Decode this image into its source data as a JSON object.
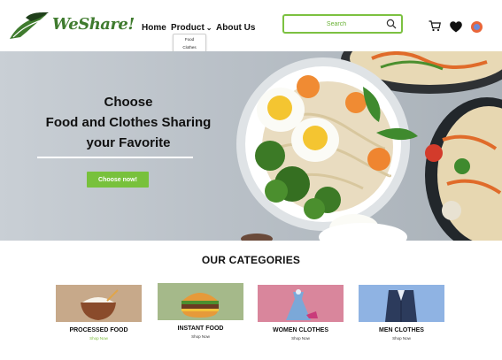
{
  "brand": {
    "name": "WeShare!"
  },
  "nav": {
    "home": "Home",
    "product": "Product",
    "about": "About Us",
    "product_menu": [
      "Food",
      "Clothes"
    ]
  },
  "search": {
    "placeholder": "Search"
  },
  "hero": {
    "line1": "Choose",
    "line2": "Food and Clothes Sharing",
    "line3": "your Favorite",
    "cta": "Choose now!"
  },
  "categories": {
    "heading": "OUR CATEGORIES",
    "items": [
      {
        "name": "PROCESSED FOOD",
        "link": "Shop Now"
      },
      {
        "name": "INSTANT FOOD",
        "link": "Shop Now"
      },
      {
        "name": "WOMEN CLOTHES",
        "link": "Shop Now"
      },
      {
        "name": "MEN CLOTHES",
        "link": "Shop Now"
      }
    ]
  },
  "colors": {
    "accent": "#78c13c",
    "brand_green": "#3f7b2e",
    "search_border": "#7cc141"
  },
  "icons": [
    "logo-leaf-icon",
    "search-icon",
    "cart-icon",
    "heart-icon",
    "avatar"
  ]
}
